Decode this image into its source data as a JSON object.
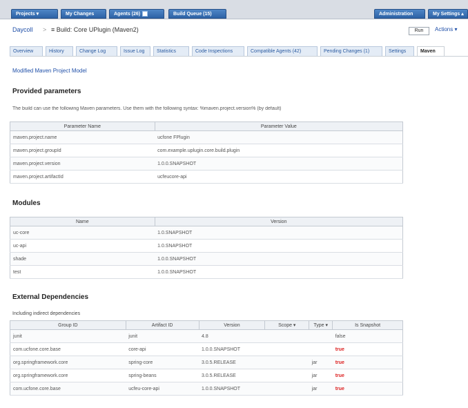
{
  "topbar": {
    "nav": [
      {
        "label": "Projects ▾"
      },
      {
        "label": "My Changes"
      },
      {
        "label": "Agents (26)"
      },
      {
        "label": "Build Queue (15)"
      }
    ],
    "right": [
      {
        "label": "Administration"
      },
      {
        "label": "My Settings ▴"
      }
    ]
  },
  "breadcrumb": {
    "project": "Daycoll",
    "separator": ">",
    "page": "≡ Build: Core UPlugin (Maven2)",
    "box_label": "Run",
    "right_label": "Actions ▾"
  },
  "tabs": [
    {
      "label": "Overview"
    },
    {
      "label": "History"
    },
    {
      "label": "Change Log"
    },
    {
      "label": "Issue Log"
    },
    {
      "label": "Statistics"
    },
    {
      "label": "Code Inspections"
    },
    {
      "label": "Compatible Agents (42)"
    },
    {
      "label": "Pending Changes (1)"
    },
    {
      "label": "Settings"
    },
    {
      "label": "Maven"
    }
  ],
  "notify_link": "Modified Maven Project Model",
  "sections": {
    "provided_title": "Provided parameters",
    "provided_desc": "The build can use the following Maven parameters. Use them with the following syntax: %maven.project.version% (by default)",
    "modules_title": "Modules",
    "external_title": "External Dependencies",
    "external_sub": "Including indirect dependencies"
  },
  "params_table": {
    "headers": [
      "Parameter Name",
      "Parameter Value"
    ],
    "rows": [
      [
        "maven.project.name",
        "ucfone FPlugin"
      ],
      [
        "maven.project.groupId",
        "com.example.uplugin.core.build.plugin"
      ],
      [
        "maven.project.version",
        "1.0.0.SNAPSHOT"
      ],
      [
        "maven.project.artifactId",
        "ucfeucore-api"
      ]
    ]
  },
  "modules_table": {
    "headers": [
      "Name",
      "Version"
    ],
    "rows": [
      [
        "uc-core",
        "1.0.SNAPSHOT"
      ],
      [
        "uc-api",
        "1.0.SNAPSHOT"
      ],
      [
        "shade",
        "1.0.0.SNAPSHOT"
      ],
      [
        "test",
        "1.0.0.SNAPSHOT"
      ]
    ]
  },
  "deps_table": {
    "headers": [
      "Group ID",
      "Artifact ID",
      "Version",
      "Scope ▾",
      "Type ▾",
      "Is Snapshot"
    ],
    "rows": [
      {
        "group": "junit",
        "artifact": "junit",
        "version": "4.8",
        "scope": "",
        "type": "",
        "snapshot": "false",
        "red": false
      },
      {
        "group": "com.ucfone.core.base",
        "artifact": "core-api",
        "version": "1.0.0.SNAPSHOT",
        "scope": "",
        "type": "",
        "snapshot": "true",
        "red": true
      },
      {
        "group": "org.springframework.core",
        "artifact": "spring-core",
        "version": "3.0.5.RELEASE",
        "scope": "",
        "type": "jar",
        "snapshot": "true",
        "red": true
      },
      {
        "group": "org.springframework.core",
        "artifact": "spring-beans",
        "version": "3.0.5.RELEASE",
        "scope": "",
        "type": "jar",
        "snapshot": "true",
        "red": true
      },
      {
        "group": "com.ucfone.core.base",
        "artifact": "ucfeu-core-api",
        "version": "1.0.0.SNAPSHOT",
        "scope": "",
        "type": "jar",
        "snapshot": "true",
        "red": true
      }
    ]
  }
}
